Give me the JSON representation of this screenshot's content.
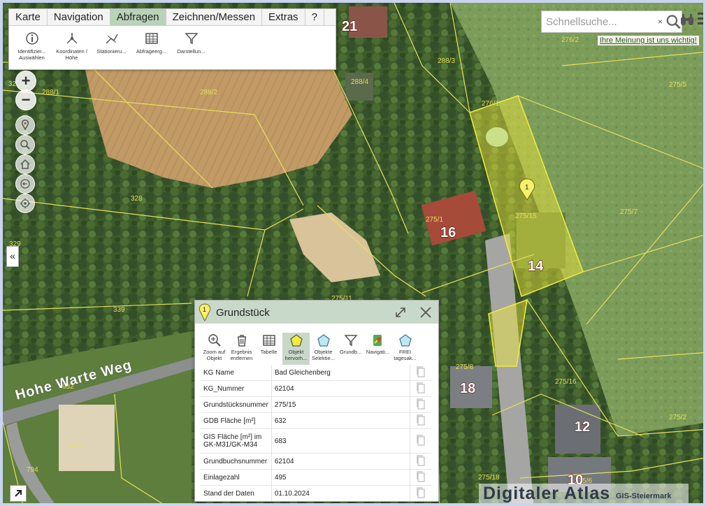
{
  "menu": {
    "tabs": [
      {
        "label": "Karte"
      },
      {
        "label": "Navigation"
      },
      {
        "label": "Abfragen"
      },
      {
        "label": "Zeichnen/Messen"
      },
      {
        "label": "Extras"
      },
      {
        "label": "?"
      }
    ],
    "active_tab": "Abfragen",
    "tools": [
      {
        "label": "Identifizier... Auswählen",
        "icon": "info-icon"
      },
      {
        "label": "Koordinaten / Höhe",
        "icon": "coordinates-icon"
      },
      {
        "label": "Stationieru...",
        "icon": "stationing-icon"
      },
      {
        "label": "Abfrageerg...",
        "icon": "table-icon"
      },
      {
        "label": "Darstellun...",
        "icon": "filter-icon"
      }
    ]
  },
  "search": {
    "placeholder": "Schnellsuche...",
    "clear": "×"
  },
  "feedback_link": "Ihre Meinung ist uns wichtig!",
  "zoom": {
    "in": "+",
    "out": "−"
  },
  "collapse_label": "«",
  "map": {
    "street_name": "Hohe Warte Weg",
    "parcel_labels": [
      "288/3",
      "288/4",
      "288/1",
      "288/2",
      "276/1",
      "276/2",
      "275/5",
      "275/7",
      "275/1",
      "275/15",
      "328",
      "329",
      "339",
      "275/11",
      "275/8",
      "275/16",
      "275/2",
      "275/6",
      "275/18",
      "301/4",
      "794",
      "932",
      "32"
    ],
    "house_numbers": [
      "21",
      "16",
      "14",
      "18",
      "12",
      "10"
    ],
    "marker_label": "1",
    "highlight_color": "#f3ec3a"
  },
  "watermark": {
    "title": "Digitaler Atlas",
    "subtitle": "GIS-Steiermark"
  },
  "popup": {
    "title": "Grundstück",
    "marker_label": "1",
    "tools": [
      {
        "label": "Zoom auf Objekt",
        "icon": "zoom-to-object-icon"
      },
      {
        "label": "Ergebnis entfernen",
        "icon": "trash-icon"
      },
      {
        "label": "Tabelle",
        "icon": "table-icon"
      },
      {
        "label": "Objekt hervorh...",
        "icon": "highlight-object-icon"
      },
      {
        "label": "Objekte Selektie...",
        "icon": "select-objects-icon"
      },
      {
        "label": "Grundb...",
        "icon": "filter-icon"
      },
      {
        "label": "Navigati...",
        "icon": "navigation-icon"
      },
      {
        "label": "FREI tagesak...",
        "icon": "free-daily-icon"
      }
    ],
    "active_tool": "Objekt hervorh...",
    "rows": [
      {
        "key": "KG Name",
        "value": "Bad Gleichenberg"
      },
      {
        "key": "KG_Nummer",
        "value": "62104"
      },
      {
        "key": "Grundstücksnummer",
        "value": "275/15"
      },
      {
        "key": "GDB Fläche [m²]",
        "value": "632"
      },
      {
        "key": "GIS Fläche [m²] im GK-M31/GK-M34",
        "value": "683"
      },
      {
        "key": "Grundbuchsnummer",
        "value": "62104"
      },
      {
        "key": "Einlagezahl",
        "value": "495"
      },
      {
        "key": "Stand der Daten",
        "value": "01.10.2024"
      }
    ]
  }
}
